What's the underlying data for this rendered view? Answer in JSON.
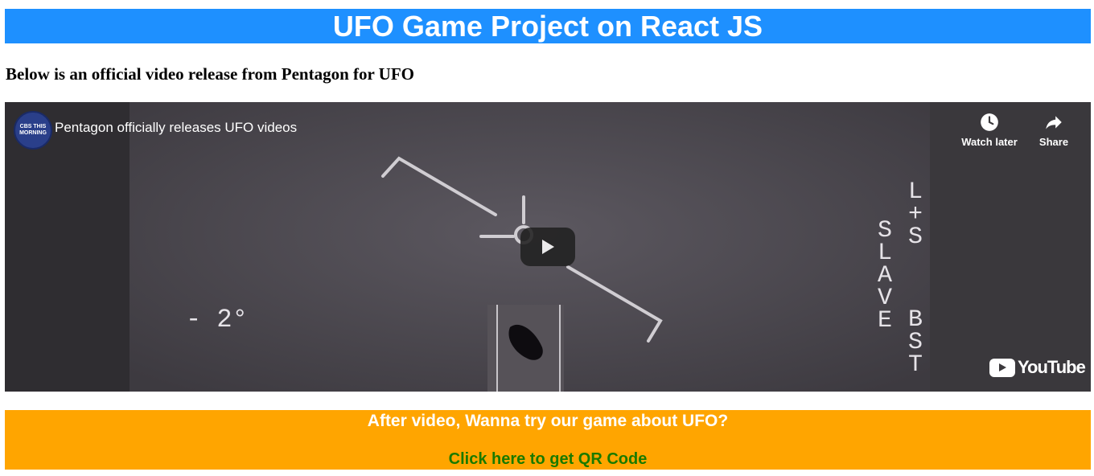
{
  "header": {
    "title": "UFO Game Project on React JS"
  },
  "intro": {
    "text": "Below is an official video release from Pentagon for UFO"
  },
  "video": {
    "channel_logo_text": "CBS THIS MORNING",
    "title": "Pentagon officially releases UFO videos",
    "actions": [
      {
        "label": "Watch later",
        "icon": "clock-icon"
      },
      {
        "label": "Share",
        "icon": "share-icon"
      }
    ],
    "overlay": {
      "angle": "- 2°",
      "right_col1": "L+S",
      "right_col2": "SLAVE",
      "right_col3": "BST"
    },
    "brand": "YouTube",
    "colors": {
      "play_button": "#212121",
      "frame": "#3b393c"
    }
  },
  "cta": {
    "text": "After video, Wanna try our game about UFO?",
    "link": "Click here to get QR Code",
    "colors": {
      "background": "#ffa500",
      "link": "#1a7a00"
    }
  },
  "colors": {
    "header_bg": "#1e90ff"
  }
}
